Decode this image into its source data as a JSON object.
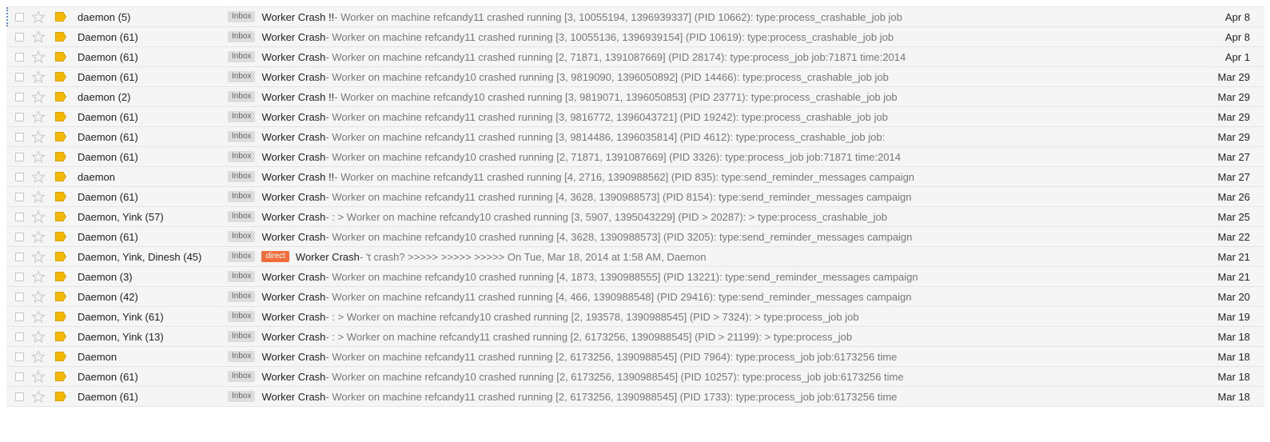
{
  "colors": {
    "row_bg": "#f5f5f5",
    "direct_tag": "#f36c3b",
    "inbox_tag": "#dddddd",
    "label_icon": "#f5b800"
  },
  "threads": [
    {
      "sender": "daemon (5)",
      "tag": "Inbox",
      "extra_tag": "",
      "subject": "Worker Crash !!",
      "snippet": " - Worker on machine refcandy11 crashed running [3, 10055194, 1396939337] (PID 10662): type:process_crashable_job job",
      "date": "Apr 8"
    },
    {
      "sender": "Daemon (61)",
      "tag": "Inbox",
      "extra_tag": "",
      "subject": "Worker Crash",
      "snippet": " - Worker on machine refcandy11 crashed running [3, 10055136, 1396939154] (PID 10619): type:process_crashable_job job",
      "date": "Apr 8"
    },
    {
      "sender": "Daemon (61)",
      "tag": "Inbox",
      "extra_tag": "",
      "subject": "Worker Crash",
      "snippet": " - Worker on machine refcandy11 crashed running [2, 71871, 1391087669] (PID 28174): type:process_job job:71871 time:2014",
      "date": "Apr 1"
    },
    {
      "sender": "Daemon (61)",
      "tag": "Inbox",
      "extra_tag": "",
      "subject": "Worker Crash",
      "snippet": " - Worker on machine refcandy10 crashed running [3, 9819090, 1396050892] (PID 14466): type:process_crashable_job job",
      "date": "Mar 29"
    },
    {
      "sender": "daemon (2)",
      "tag": "Inbox",
      "extra_tag": "",
      "subject": "Worker Crash !!",
      "snippet": " - Worker on machine refcandy10 crashed running [3, 9819071, 1396050853] (PID 23771): type:process_crashable_job job",
      "date": "Mar 29"
    },
    {
      "sender": "Daemon (61)",
      "tag": "Inbox",
      "extra_tag": "",
      "subject": "Worker Crash",
      "snippet": " - Worker on machine refcandy11 crashed running [3, 9816772, 1396043721] (PID 19242): type:process_crashable_job job",
      "date": "Mar 29"
    },
    {
      "sender": "Daemon (61)",
      "tag": "Inbox",
      "extra_tag": "",
      "subject": "Worker Crash",
      "snippet": " - Worker on machine refcandy11 crashed running [3, 9814486, 1396035814] (PID 4612): type:process_crashable_job job:",
      "date": "Mar 29"
    },
    {
      "sender": "Daemon (61)",
      "tag": "Inbox",
      "extra_tag": "",
      "subject": "Worker Crash",
      "snippet": " - Worker on machine refcandy10 crashed running [2, 71871, 1391087669] (PID 3326): type:process_job job:71871 time:2014",
      "date": "Mar 27"
    },
    {
      "sender": "daemon",
      "tag": "Inbox",
      "extra_tag": "",
      "subject": "Worker Crash !!",
      "snippet": " - Worker on machine refcandy11 crashed running [4, 2716, 1390988562] (PID 835): type:send_reminder_messages campaign",
      "date": "Mar 27"
    },
    {
      "sender": "Daemon (61)",
      "tag": "Inbox",
      "extra_tag": "",
      "subject": "Worker Crash",
      "snippet": " - Worker on machine refcandy11 crashed running [4, 3628, 1390988573] (PID 8154): type:send_reminder_messages campaign",
      "date": "Mar 26"
    },
    {
      "sender": "Daemon, Yink (57)",
      "tag": "Inbox",
      "extra_tag": "",
      "subject": "Worker Crash",
      "snippet": " - : > Worker on machine refcandy10 crashed running [3, 5907, 1395043229] (PID > 20287): > type:process_crashable_job",
      "date": "Mar 25"
    },
    {
      "sender": "Daemon (61)",
      "tag": "Inbox",
      "extra_tag": "",
      "subject": "Worker Crash",
      "snippet": " - Worker on machine refcandy10 crashed running [4, 3628, 1390988573] (PID 3205): type:send_reminder_messages campaign",
      "date": "Mar 22"
    },
    {
      "sender": "Daemon, Yink, Dinesh (45)",
      "tag": "Inbox",
      "extra_tag": "direct",
      "subject": "Worker Crash",
      "snippet": " - 't crash? >>>>> >>>>> >>>>> On Tue, Mar 18, 2014 at 1:58 AM, Daemon",
      "date": "Mar 21"
    },
    {
      "sender": "Daemon (3)",
      "tag": "Inbox",
      "extra_tag": "",
      "subject": "Worker Crash",
      "snippet": " - Worker on machine refcandy10 crashed running [4, 1873, 1390988555] (PID 13221): type:send_reminder_messages campaign",
      "date": "Mar 21"
    },
    {
      "sender": "Daemon (42)",
      "tag": "Inbox",
      "extra_tag": "",
      "subject": "Worker Crash",
      "snippet": " - Worker on machine refcandy11 crashed running [4, 466, 1390988548] (PID 29416): type:send_reminder_messages campaign",
      "date": "Mar 20"
    },
    {
      "sender": "Daemon, Yink (61)",
      "tag": "Inbox",
      "extra_tag": "",
      "subject": "Worker Crash",
      "snippet": " - : > Worker on machine refcandy10 crashed running [2, 193578, 1390988545] (PID > 7324): > type:process_job job",
      "date": "Mar 19"
    },
    {
      "sender": "Daemon, Yink (13)",
      "tag": "Inbox",
      "extra_tag": "",
      "subject": "Worker Crash",
      "snippet": " - : > Worker on machine refcandy11 crashed running [2, 6173256, 1390988545] (PID > 21199): > type:process_job",
      "date": "Mar 18"
    },
    {
      "sender": "Daemon",
      "tag": "Inbox",
      "extra_tag": "",
      "subject": "Worker Crash",
      "snippet": " - Worker on machine refcandy11 crashed running [2, 6173256, 1390988545] (PID 7964): type:process_job job:6173256 time",
      "date": "Mar 18"
    },
    {
      "sender": "Daemon (61)",
      "tag": "Inbox",
      "extra_tag": "",
      "subject": "Worker Crash",
      "snippet": " - Worker on machine refcandy10 crashed running [2, 6173256, 1390988545] (PID 10257): type:process_job job:6173256 time",
      "date": "Mar 18"
    },
    {
      "sender": "Daemon (61)",
      "tag": "Inbox",
      "extra_tag": "",
      "subject": "Worker Crash",
      "snippet": " - Worker on machine refcandy11 crashed running [2, 6173256, 1390988545] (PID 1733): type:process_job job:6173256 time",
      "date": "Mar 18"
    }
  ]
}
